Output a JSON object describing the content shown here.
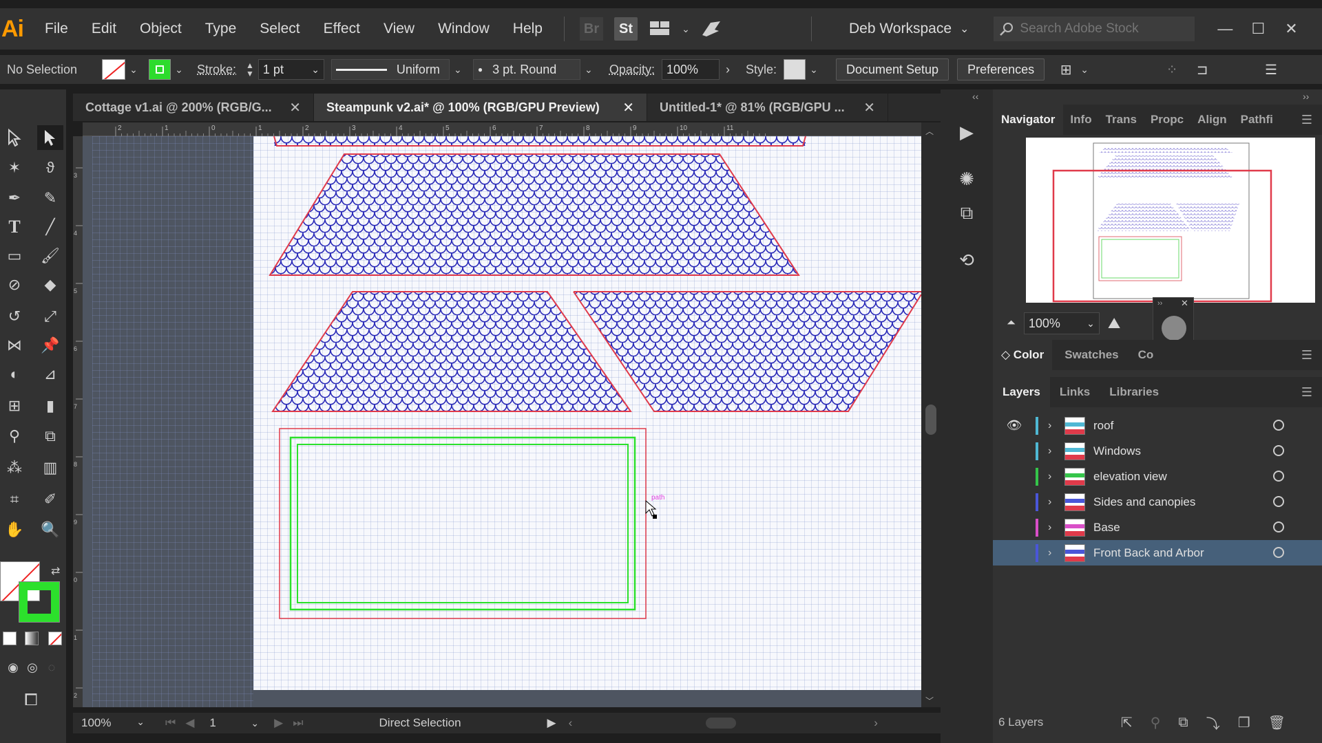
{
  "app": {
    "logo": "Ai"
  },
  "menu": [
    "File",
    "Edit",
    "Object",
    "Type",
    "Select",
    "Effect",
    "View",
    "Window",
    "Help"
  ],
  "menubar_icons": {
    "bridge": "Br",
    "stock": "St"
  },
  "workspace": "Deb Workspace",
  "stock_search": {
    "placeholder": "Search Adobe Stock"
  },
  "control": {
    "selection": "No Selection",
    "stroke_label": "Stroke:",
    "stroke_weight": "1 pt",
    "profile": "Uniform",
    "brush": "3 pt. Round",
    "opacity_label": "Opacity:",
    "opacity_value": "100%",
    "style_label": "Style:",
    "document_setup": "Document Setup",
    "preferences": "Preferences"
  },
  "tabs": [
    {
      "label": "Cottage v1.ai @ 200% (RGB/G...",
      "active": false
    },
    {
      "label": "Steampunk v2.ai* @ 100% (RGB/GPU Preview)",
      "active": true
    },
    {
      "label": "Untitled-1* @ 81% (RGB/GPU ...",
      "active": false
    }
  ],
  "ruler_top": [
    "2",
    "1",
    "0",
    "1",
    "2",
    "3",
    "4",
    "5",
    "6",
    "7",
    "8",
    "9",
    "10",
    "11"
  ],
  "ruler_left": [
    "3",
    "4",
    "5",
    "6",
    "7",
    "8",
    "9",
    "0",
    "1",
    "2"
  ],
  "cursor_label": "path",
  "status": {
    "zoom": "100%",
    "artboard": "1",
    "tool": "Direct Selection"
  },
  "navigator": {
    "tabs": [
      "Navigator",
      "Info",
      "Trans",
      "Propc",
      "Align",
      "Pathfi"
    ],
    "zoom": "100%"
  },
  "color_panel": {
    "tabs": [
      "Color",
      "Swatches",
      "Co"
    ]
  },
  "layers_panel": {
    "tabs": [
      "Layers",
      "Links",
      "Libraries"
    ],
    "layers": [
      {
        "name": "roof",
        "color": "#4fb8d4",
        "visible": true,
        "selected": false
      },
      {
        "name": "Windows",
        "color": "#4fb8d4",
        "visible": false,
        "selected": false
      },
      {
        "name": "elevation view",
        "color": "#35c54a",
        "visible": false,
        "selected": false
      },
      {
        "name": "Sides and canopies",
        "color": "#4a56d8",
        "visible": false,
        "selected": false
      },
      {
        "name": "Base",
        "color": "#d94fc8",
        "visible": false,
        "selected": false
      },
      {
        "name": "Front Back and Arbor",
        "color": "#4a56d8",
        "visible": false,
        "selected": true
      }
    ],
    "count": "6 Layers"
  },
  "colors": {
    "fish_scale": "#2a2ab8",
    "outline": "#e03a4a",
    "green_rect": "#2ce02c",
    "selection_highlight": "#46607a"
  }
}
